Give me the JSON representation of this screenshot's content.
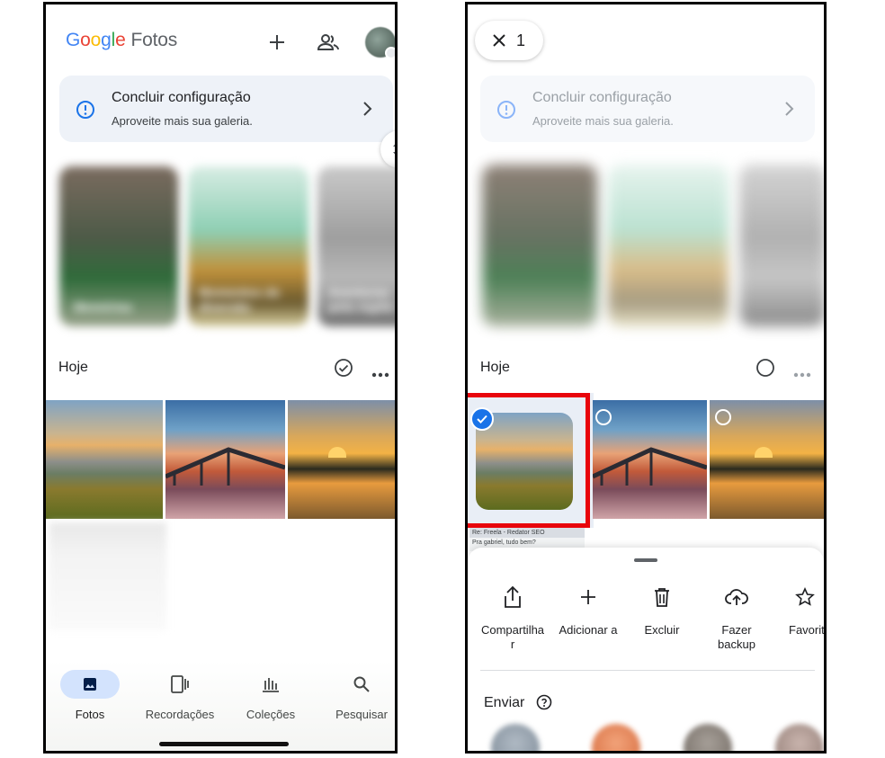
{
  "left": {
    "logo": {
      "g1": "G",
      "g2": "o",
      "g3": "o",
      "g4": "g",
      "g5": "l",
      "g6": "e",
      "product": "Fotos"
    },
    "header_icons": [
      "add-icon",
      "shared-people-icon",
      "account-avatar"
    ],
    "setup_card": {
      "title": "Concluir configuração",
      "subtitle": "Aproveite mais sua galeria."
    },
    "memories": [
      {
        "caption": "Memórias"
      },
      {
        "caption": "Momentos de diversão"
      },
      {
        "caption": "Aventuras pela região"
      }
    ],
    "day_section": {
      "label": "Hoje"
    },
    "nav": {
      "items": [
        {
          "label": "Fotos",
          "icon": "photo-icon",
          "active": true
        },
        {
          "label": "Recordações",
          "icon": "memories-icon",
          "active": false
        },
        {
          "label": "Coleções",
          "icon": "collections-icon",
          "active": false
        },
        {
          "label": "Pesquisar",
          "icon": "search-icon",
          "active": false
        }
      ]
    }
  },
  "right": {
    "selection": {
      "count": "1"
    },
    "setup_card": {
      "title": "Concluir configuração",
      "subtitle": "Aproveite mais sua galeria."
    },
    "day_section": {
      "label": "Hoje"
    },
    "email_preview": {
      "line1": "Re: Freela - Redator SEO",
      "line2": "Pra gabriel, tudo bem?"
    },
    "actions": [
      {
        "label": "Compartilha r",
        "icon": "share-icon"
      },
      {
        "label": "Adicionar a",
        "icon": "add-icon"
      },
      {
        "label": "Excluir",
        "icon": "trash-icon"
      },
      {
        "label": "Fazer backup",
        "icon": "cloud-upload-icon"
      },
      {
        "label": "Favorit",
        "icon": "star-icon"
      }
    ],
    "send": {
      "title": "Enviar",
      "help_icon": "help-icon"
    }
  },
  "colors": {
    "accent": "#1a73e8",
    "highlight": "#e8050b",
    "nav_active": "#d3e3fd"
  }
}
